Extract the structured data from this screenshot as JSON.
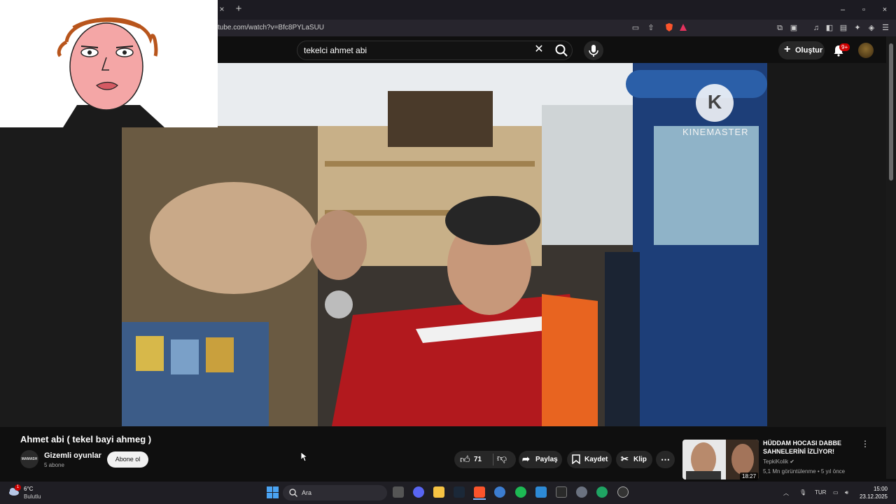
{
  "browser": {
    "tab_close": "×",
    "new_tab": "+",
    "window_controls": [
      "–",
      "▫",
      "×"
    ],
    "url": "tube.com/watch?v=Bfc8PYLaSUU"
  },
  "youtube": {
    "search_value": "tekelci ahmet abi",
    "create_label": "Oluştur",
    "notification_count": "9+",
    "video_watermark": "KINEMASTER",
    "video_watermark_logo": "K"
  },
  "video_info": {
    "title": "Ahmet abi ( tekel bayi ahmeg )",
    "channel_avatar_text": "MAMASH",
    "channel_name": "Gizemli oyunlar",
    "subscribers": "5 abone",
    "subscribe_label": "Abone ol",
    "likes": "71",
    "share_label": "Paylaş",
    "save_label": "Kaydet",
    "clip_label": "Klip"
  },
  "recommendation": {
    "title": "HÜDDAM HOCASI DABBE SAHNELERİNİ İZLİYOR!",
    "channel": "TepkiKolik",
    "meta": "5,1 Mn görüntülenme • 5 yıl önce",
    "duration": "18:27"
  },
  "taskbar": {
    "weather_alert": "1",
    "temperature": "6°C",
    "condition": "Bulutlu",
    "search_placeholder": "Ara",
    "lang": "TUR",
    "time": "15:00",
    "date": "23.12.2025"
  },
  "colors": {
    "accent_red": "#cc0000",
    "subscribe_bg": "#f1f1f1",
    "page_bg": "#0f0f0f"
  }
}
